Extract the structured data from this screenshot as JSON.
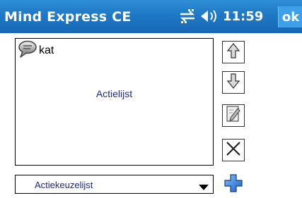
{
  "titlebar": {
    "app_title": "Mind Express CE",
    "clock": "11:59",
    "ok_label": "ok"
  },
  "action_list": {
    "items": [
      {
        "label": "kat",
        "icon": "speech-bubble-icon"
      }
    ],
    "center_label": "Actielijst"
  },
  "side_buttons": [
    {
      "name": "move-up-button",
      "icon": "arrow-up-icon"
    },
    {
      "name": "move-down-button",
      "icon": "arrow-down-icon"
    },
    {
      "name": "edit-button",
      "icon": "edit-document-icon"
    },
    {
      "name": "delete-button",
      "icon": "close-x-icon"
    },
    {
      "name": "add-button",
      "icon": "plus-icon"
    }
  ],
  "dropdown": {
    "selected": "Actiekeuzelijst"
  },
  "colors": {
    "titlebar": "#1f78c6",
    "ok_button": "#3ea0e8",
    "list_text": "#1e2a8c",
    "add_icon": "#2a78d8"
  }
}
